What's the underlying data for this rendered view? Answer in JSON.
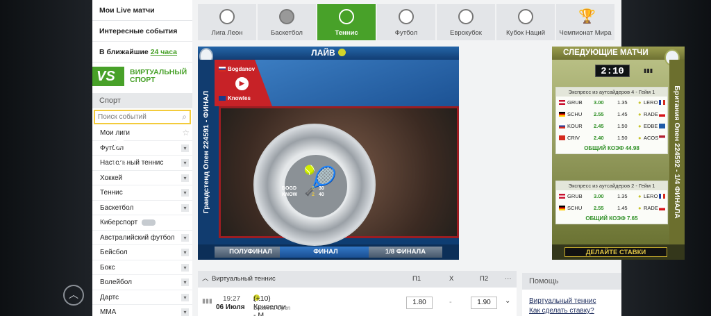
{
  "sidebar": {
    "my_live": "Мои Live матчи",
    "interesting": "Интересные события",
    "soon_prefix": "В ближайшие ",
    "soon_link": "24 часа",
    "vs_badge": "VS",
    "vs_line1": "ВИРТУАЛЬНЫЙ",
    "vs_line2": "СПОРТ",
    "sport_header": "Спорт",
    "search_placeholder": "Поиск событий",
    "my_leagues": "Мои лиги",
    "items": [
      "Футбол",
      "Настольный теннис",
      "Хоккей",
      "Теннис",
      "Баскетбол",
      "Киберспорт",
      "Австралийский футбол",
      "Бейсбол",
      "Бокс",
      "Волейбол",
      "Дартс",
      "MMA"
    ]
  },
  "tabs": [
    {
      "label": "Лига Леон",
      "icon": "soccer-ball-icon"
    },
    {
      "label": "Баскетбол",
      "icon": "basketball-icon"
    },
    {
      "label": "Теннис",
      "icon": "tennis-ball-icon",
      "active": true
    },
    {
      "label": "Футбол",
      "icon": "soccer-ball-icon"
    },
    {
      "label": "Еврокубок",
      "icon": "soccer-ball-icon"
    },
    {
      "label": "Кубок Наций",
      "icon": "soccer-ball-icon"
    },
    {
      "label": "Чемпионат Мира",
      "icon": "trophy-icon"
    }
  ],
  "live": {
    "title": "ЛАЙВ",
    "side_label": "Грандстенд Опен 224591 - ФИНАЛ",
    "player1": "Bogdanov",
    "player2": "Knowles",
    "score1_name": "BOGD",
    "score2_name": "KNOW",
    "score1_game": "0",
    "score1_points": "30",
    "score2_game": "2",
    "score2_points": "40",
    "rounds": [
      "ПОЛУФИНАЛ",
      "ФИНАЛ",
      "1/8 ФИНАЛА"
    ]
  },
  "next": {
    "title": "СЛЕДУЮЩИЕ МАТЧИ",
    "timer": "2:10",
    "side_label": "Британия Опен 224592 - 1/4 ФИНАЛА",
    "cards": [
      {
        "header": "Экспресс из аутсайдеров 4 - Гейм 1",
        "rows": [
          {
            "a": "GRUB",
            "odd": "3.00",
            "x": "1.35",
            "b": "LERO"
          },
          {
            "a": "SCHU",
            "odd": "2.55",
            "x": "1.45",
            "b": "RADE"
          },
          {
            "a": "KOUR",
            "odd": "2.45",
            "x": "1.50",
            "b": "EDBE"
          },
          {
            "a": "CRIV",
            "odd": "2.40",
            "x": "1.50",
            "b": "ACOS"
          }
        ],
        "total": "ОБЩИЙ КОЭФ 44.98"
      },
      {
        "header": "Экспресс из аутсайдеров 2 - Гейм 1",
        "rows": [
          {
            "a": "GRUB",
            "odd": "3.00",
            "x": "1.35",
            "b": "LERO"
          },
          {
            "a": "SCHU",
            "odd": "2.55",
            "x": "1.45",
            "b": "RADE"
          }
        ],
        "total": "ОБЩИЙ КОЭФ 7.65"
      }
    ],
    "bet_button": "ДЕЛАЙТЕ СТАВКИ"
  },
  "events": {
    "title": "Виртуальный теннис",
    "col_p1": "П1",
    "col_x": "X",
    "col_p2": "П2",
    "more": "···",
    "row": {
      "time": "19:27",
      "date": "06 Июля",
      "name": "А. Кривелли - М. Акоста",
      "extra": "(+10)",
      "league": "Britannia Open",
      "p1": "1.80",
      "x": "-",
      "p2": "1.90"
    }
  },
  "help": {
    "title": "Помощь",
    "link1": "Виртуальный теннис",
    "link2": "Как сделать ставку?"
  },
  "colors": {
    "brand": "#48a129",
    "accent": "#f3cb3b"
  }
}
